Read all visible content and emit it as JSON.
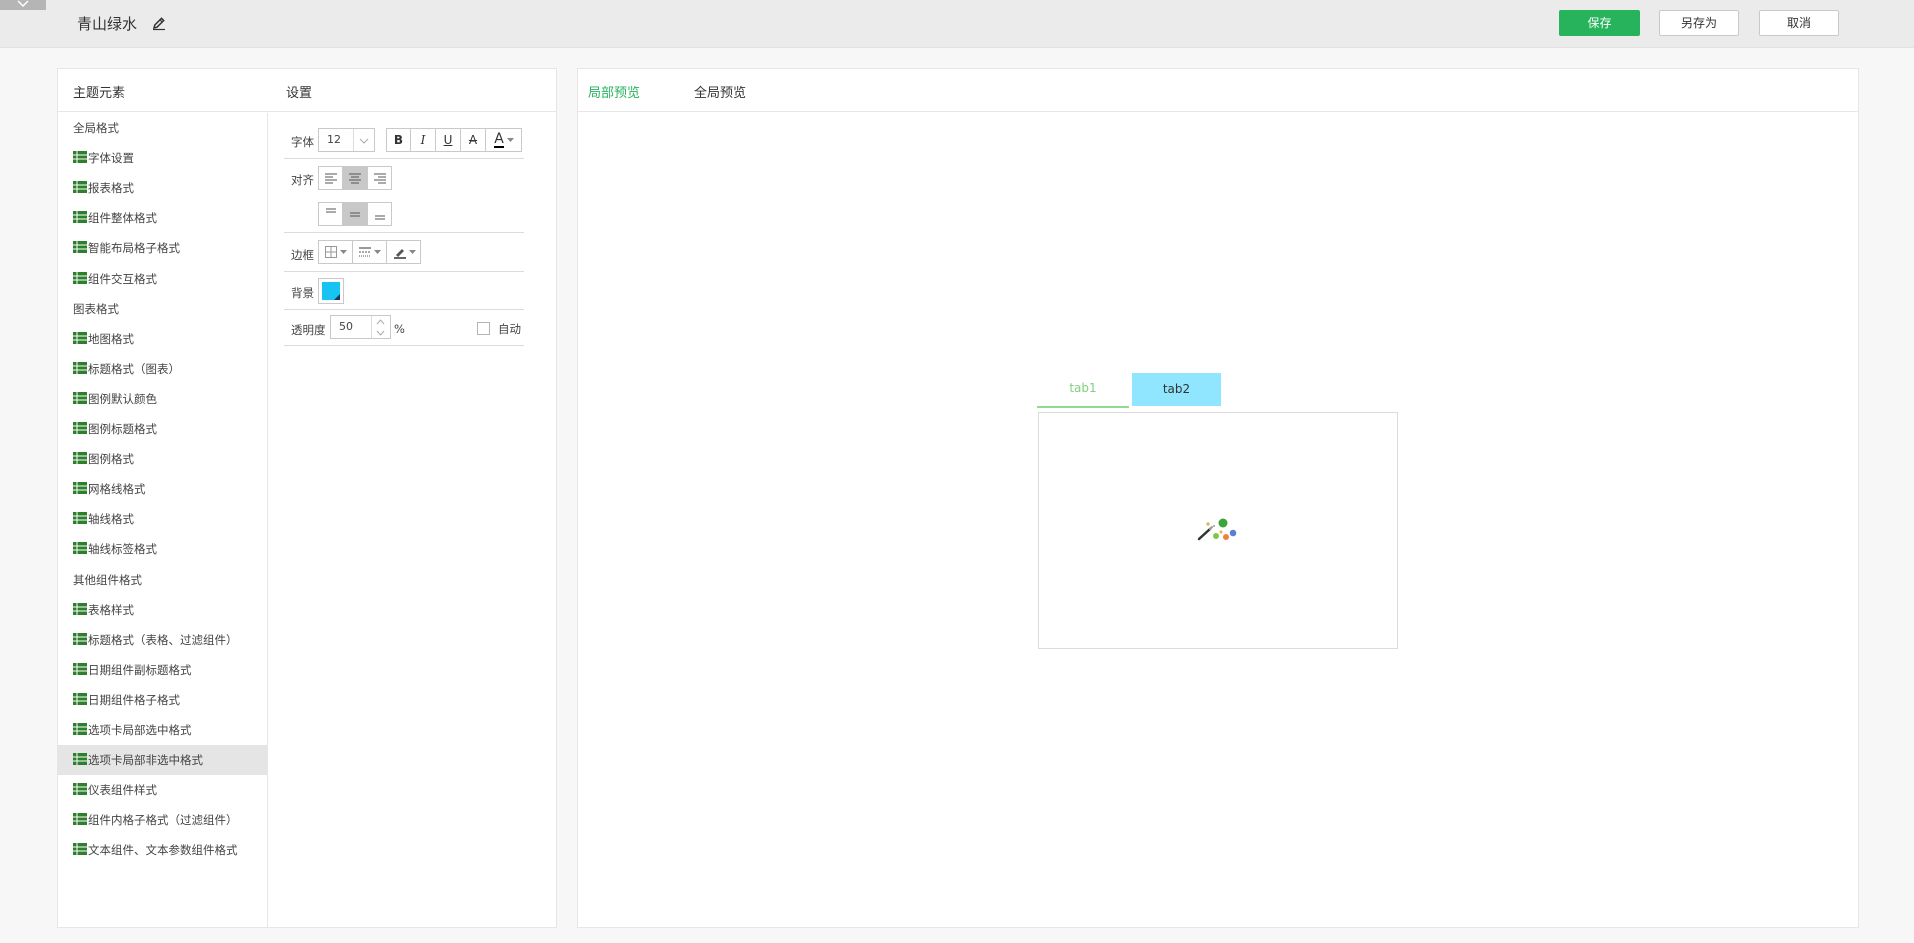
{
  "header": {
    "theme_name": "青山绿水",
    "save_label": "保存",
    "saveas_label": "另存为",
    "cancel_label": "取消"
  },
  "left_panel": {
    "elements_title": "主题元素",
    "settings_title": "设置"
  },
  "tree": [
    {
      "label": "全局格式",
      "group": true
    },
    {
      "label": "字体设置",
      "group": false
    },
    {
      "label": "报表格式",
      "group": false
    },
    {
      "label": "组件整体格式",
      "group": false
    },
    {
      "label": "智能布局格子格式",
      "group": false
    },
    {
      "label": "组件交互格式",
      "group": false
    },
    {
      "label": "图表格式",
      "group": true
    },
    {
      "label": "地图格式",
      "group": false
    },
    {
      "label": "标题格式（图表）",
      "group": false
    },
    {
      "label": "图例默认颜色",
      "group": false
    },
    {
      "label": "图例标题格式",
      "group": false
    },
    {
      "label": "图例格式",
      "group": false
    },
    {
      "label": "网格线格式",
      "group": false
    },
    {
      "label": "轴线格式",
      "group": false
    },
    {
      "label": "轴线标签格式",
      "group": false
    },
    {
      "label": "其他组件格式",
      "group": true
    },
    {
      "label": "表格样式",
      "group": false
    },
    {
      "label": "标题格式（表格、过滤组件）",
      "group": false
    },
    {
      "label": "日期组件副标题格式",
      "group": false
    },
    {
      "label": "日期组件格子格式",
      "group": false
    },
    {
      "label": "选项卡局部选中格式",
      "group": false
    },
    {
      "label": "选项卡局部非选中格式",
      "group": false,
      "active": true
    },
    {
      "label": "仪表组件样式",
      "group": false
    },
    {
      "label": "组件内格子格式（过滤组件）",
      "group": false
    },
    {
      "label": "文本组件、文本参数组件格式",
      "group": false
    }
  ],
  "settings": {
    "font_label": "字体",
    "font_size": "12",
    "bold": "B",
    "italic": "I",
    "underline": "U",
    "strike": "A",
    "font_color": "A",
    "align_label": "对齐",
    "border_label": "边框",
    "background_label": "背景",
    "background_color": "#17c3f0",
    "opacity_label": "透明度",
    "opacity_value": "50",
    "opacity_unit": "%",
    "auto_label": "自动"
  },
  "preview": {
    "tab_local": "局部预览",
    "tab_global": "全局预览",
    "sample_tab1": "tab1",
    "sample_tab2": "tab2"
  },
  "colors": {
    "accent": "#27b35c",
    "tab1_text": "#7fd07f",
    "tab2_bg": "#91e6ff"
  }
}
